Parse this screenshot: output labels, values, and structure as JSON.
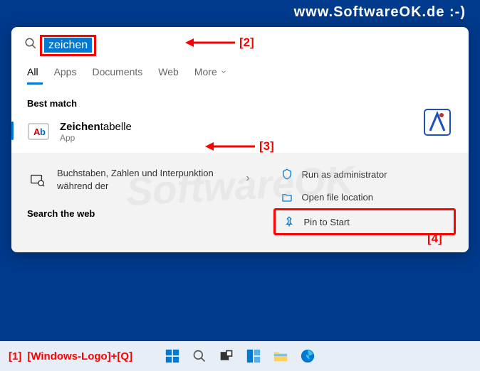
{
  "watermark": {
    "top": "www.SoftwareOK.de :-)",
    "center": "SoftwareOK"
  },
  "search": {
    "query": "zeichen"
  },
  "tabs": {
    "all": "All",
    "apps": "Apps",
    "documents": "Documents",
    "web": "Web",
    "more": "More"
  },
  "sections": {
    "best_match": "Best match",
    "search_web": "Search the web"
  },
  "result": {
    "title_bold": "Zeichen",
    "title_rest": "tabelle",
    "subtitle": "App"
  },
  "web_result": {
    "text": "Buchstaben, Zahlen und Interpunktion während der"
  },
  "context": {
    "run_admin": "Run as administrator",
    "open_location": "Open file location",
    "pin_start": "Pin to Start"
  },
  "annotations": {
    "a1": "[1]",
    "a1_text": "[Windows-Logo]+[Q]",
    "a2": "[2]",
    "a3": "[3]",
    "a4": "[4]"
  }
}
